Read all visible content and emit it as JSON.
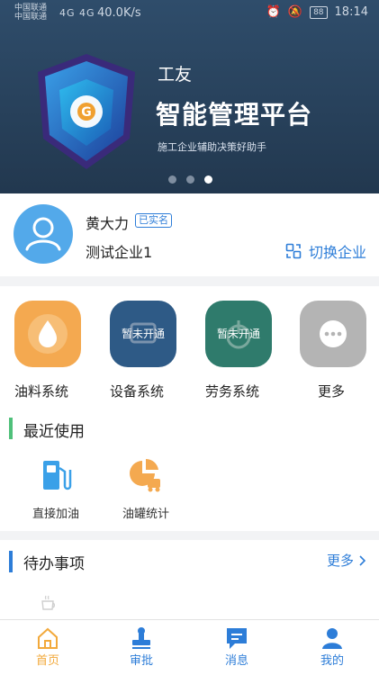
{
  "status_bar": {
    "carrier1": "中国联通",
    "carrier2": "中国联通",
    "signal": "4G 4G",
    "speed": "40.0K/s",
    "battery": "88",
    "time": "18:14"
  },
  "banner": {
    "subtitle": "工友",
    "title": "智能管理平台",
    "tagline": "施工企业辅助决策好助手",
    "slides": 3,
    "active_slide": 3
  },
  "user": {
    "name": "黄大力",
    "verified_badge": "已实名",
    "company": "测试企业1",
    "switch_label": "切换企业"
  },
  "apps": [
    {
      "label": "油料系统",
      "color": "#f4a950",
      "icon": "oil-drop-icon",
      "ribbon": ""
    },
    {
      "label": "设备系统",
      "color": "#2e5a86",
      "icon": "equipment-icon",
      "ribbon": "暂未开通"
    },
    {
      "label": "劳务系统",
      "color": "#2f7b6c",
      "icon": "labor-icon",
      "ribbon": "暂未开通"
    },
    {
      "label": "更多",
      "color": "#b4b4b4",
      "icon": "more-dots-icon",
      "ribbon": ""
    }
  ],
  "recent": {
    "title": "最近使用",
    "accent": "#4fc07a",
    "items": [
      {
        "label": "直接加油",
        "icon": "fuel-pump-icon"
      },
      {
        "label": "油罐统计",
        "icon": "tank-stats-icon"
      }
    ]
  },
  "todo": {
    "title": "待办事项",
    "accent": "#2d7dd8",
    "more_label": "更多"
  },
  "tabs": [
    {
      "label": "首页",
      "icon": "home-icon",
      "active": true
    },
    {
      "label": "审批",
      "icon": "stamp-icon",
      "active": false
    },
    {
      "label": "消息",
      "icon": "message-icon",
      "active": false
    },
    {
      "label": "我的",
      "icon": "person-icon",
      "active": false
    }
  ],
  "colors": {
    "primary": "#2d7dd8",
    "active_tab": "#f2a93b",
    "banner_bg": "#2a4563"
  }
}
